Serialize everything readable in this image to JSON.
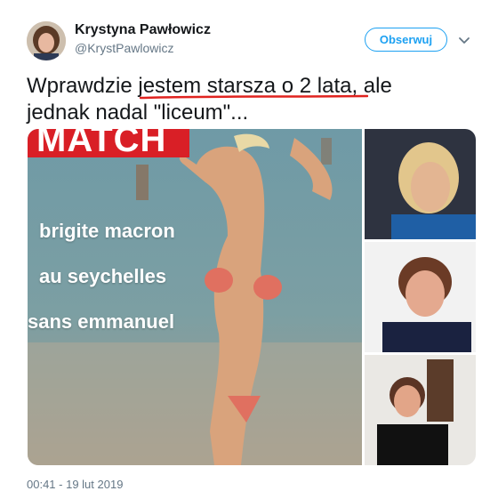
{
  "author": {
    "name": "Krystyna Pawłowicz",
    "handle": "@KrystPawlowicz"
  },
  "follow_button": {
    "label": "Obserwuj"
  },
  "tweet": {
    "text": "Wprawdzie jestem starsza o 2 lata, ale\njednak nadal \"liceum\"...",
    "timestamp": "00:41 - 19 lut 2019"
  },
  "media": {
    "main_image": {
      "banner_text": "MATCH",
      "lines": [
        "brigite macron",
        "au seychelles",
        "sans emmanuel"
      ]
    }
  },
  "colors": {
    "accent": "#1da1f2",
    "underline": "#e0231f",
    "banner": "#d91f26"
  }
}
